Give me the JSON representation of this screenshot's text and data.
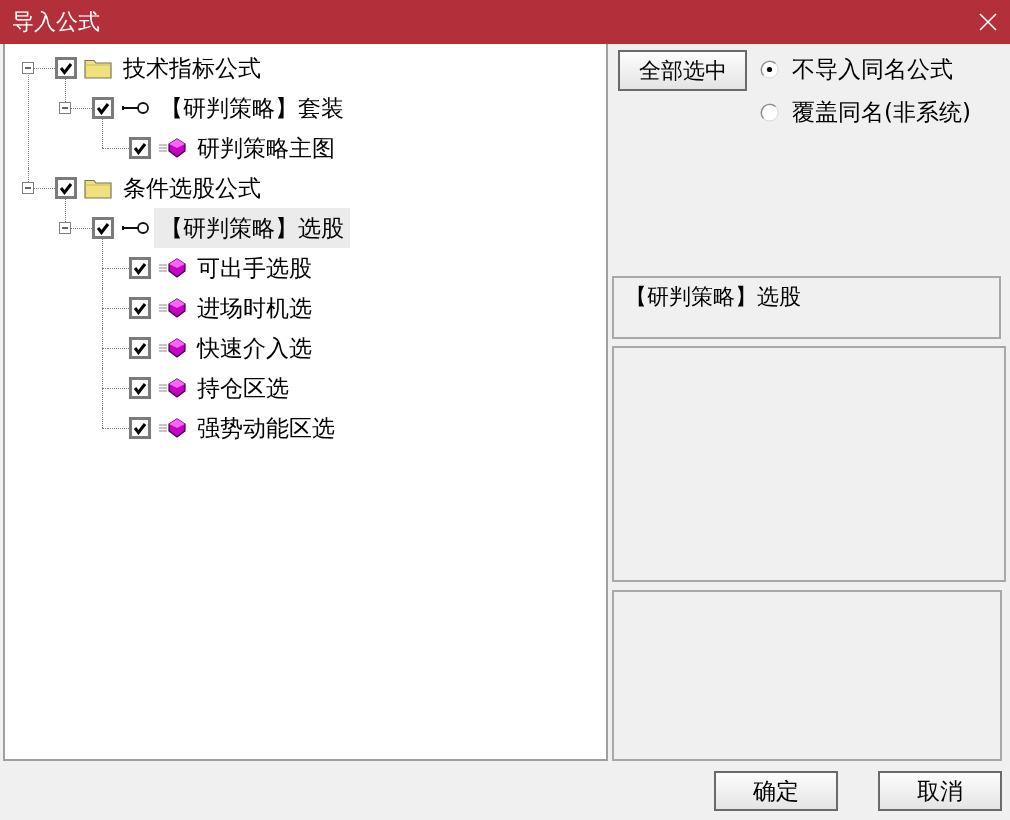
{
  "window": {
    "title": "导入公式"
  },
  "tree": [
    {
      "kind": "folder",
      "label": "技术指标公式",
      "checked": true,
      "expanded": true,
      "selected": false,
      "children": [
        {
          "kind": "group",
          "label": "【研判策略】套装",
          "checked": true,
          "expanded": true,
          "selected": false,
          "children": [
            {
              "kind": "formula",
              "label": "研判策略主图",
              "checked": true,
              "selected": false
            }
          ]
        }
      ]
    },
    {
      "kind": "folder",
      "label": "条件选股公式",
      "checked": true,
      "expanded": true,
      "selected": false,
      "children": [
        {
          "kind": "group",
          "label": "【研判策略】选股",
          "checked": true,
          "expanded": true,
          "selected": true,
          "children": [
            {
              "kind": "formula",
              "label": "可出手选股",
              "checked": true,
              "selected": false
            },
            {
              "kind": "formula",
              "label": "进场时机选",
              "checked": true,
              "selected": false
            },
            {
              "kind": "formula",
              "label": "快速介入选",
              "checked": true,
              "selected": false
            },
            {
              "kind": "formula",
              "label": "持仓区选",
              "checked": true,
              "selected": false
            },
            {
              "kind": "formula",
              "label": "强势动能区选",
              "checked": true,
              "selected": false
            }
          ]
        }
      ]
    }
  ],
  "select_all_button": "全部选中",
  "import_options": [
    {
      "label": "不导入同名公式",
      "selected": true
    },
    {
      "label": "覆盖同名(非系统)",
      "selected": false
    }
  ],
  "info_box": {
    "text": "【研判策略】选股"
  },
  "buttons": [
    {
      "label": "确定"
    },
    {
      "label": "取消"
    }
  ]
}
